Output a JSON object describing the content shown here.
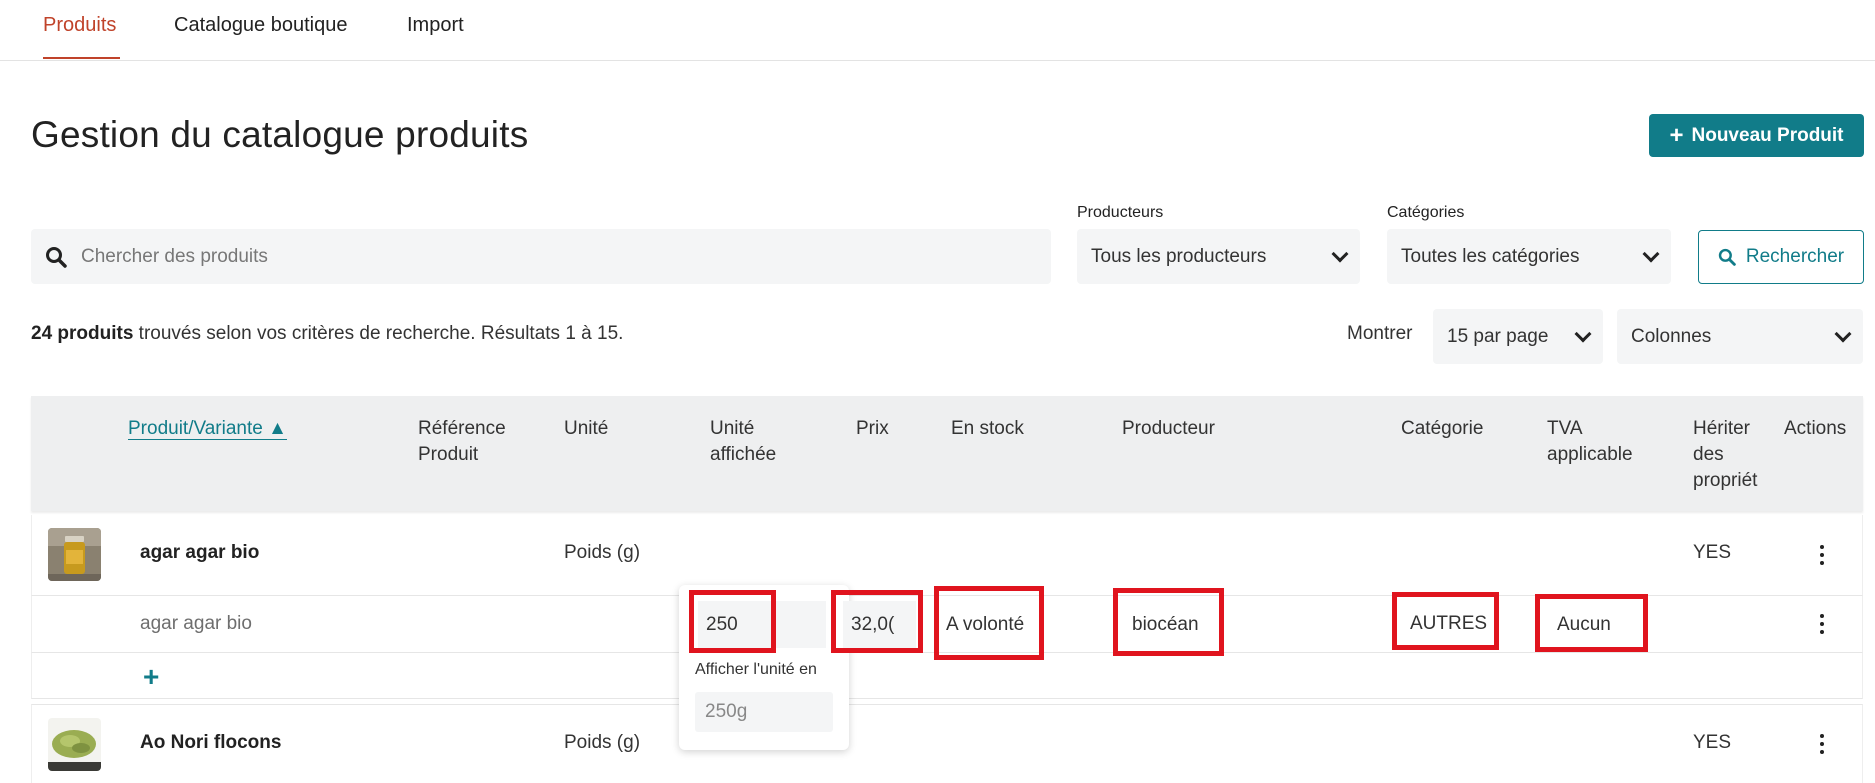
{
  "tabs": [
    {
      "label": "Produits",
      "active": true
    },
    {
      "label": "Catalogue boutique",
      "active": false
    },
    {
      "label": "Import",
      "active": false
    }
  ],
  "page_title": "Gestion du catalogue produits",
  "new_product_button": {
    "icon": "plus-icon",
    "label": "Nouveau Produit"
  },
  "search": {
    "placeholder": "Chercher des produits",
    "icon": "search-icon"
  },
  "filters": {
    "producers": {
      "label": "Producteurs",
      "value": "Tous les producteurs"
    },
    "categories": {
      "label": "Catégories",
      "value": "Toutes les catégories"
    }
  },
  "search_button": {
    "icon": "search-icon",
    "label": "Rechercher"
  },
  "results": {
    "count": "24 produits",
    "text": " trouvés selon vos critères de recherche. Résultats 1 à 15."
  },
  "show": {
    "label": "Montrer",
    "per_page": "15 par page",
    "columns": "Colonnes"
  },
  "table": {
    "headers": {
      "product": "Produit/Variante ▲",
      "reference": [
        "Référence",
        "Produit"
      ],
      "unit": "Unité",
      "displayed_unit": [
        "Unité",
        "affichée"
      ],
      "price": "Prix",
      "stock": "En stock",
      "producer": "Producteur",
      "category": "Catégorie",
      "vat": [
        "TVA",
        "applicable"
      ],
      "inherit": [
        "Hériter",
        "des",
        "propriét"
      ],
      "actions": "Actions"
    },
    "rows": [
      {
        "name": "agar agar bio",
        "unit": "Poids (g)",
        "inherit": "YES"
      },
      {
        "name": "Ao Nori flocons",
        "unit": "Poids (g)",
        "inherit": "YES"
      }
    ],
    "variant": {
      "name": "agar agar bio",
      "displayed_unit": "250",
      "price": "32,0(",
      "stock": "A volonté",
      "producer": "biocéan",
      "category": "AUTRES",
      "vat": "Aucun"
    },
    "unit_popup": {
      "title": "Afficher l'unité en",
      "value": "250g"
    }
  },
  "colors": {
    "accent": "#117c89",
    "active_tab": "#c0432a",
    "highlight": "#e0141e"
  }
}
